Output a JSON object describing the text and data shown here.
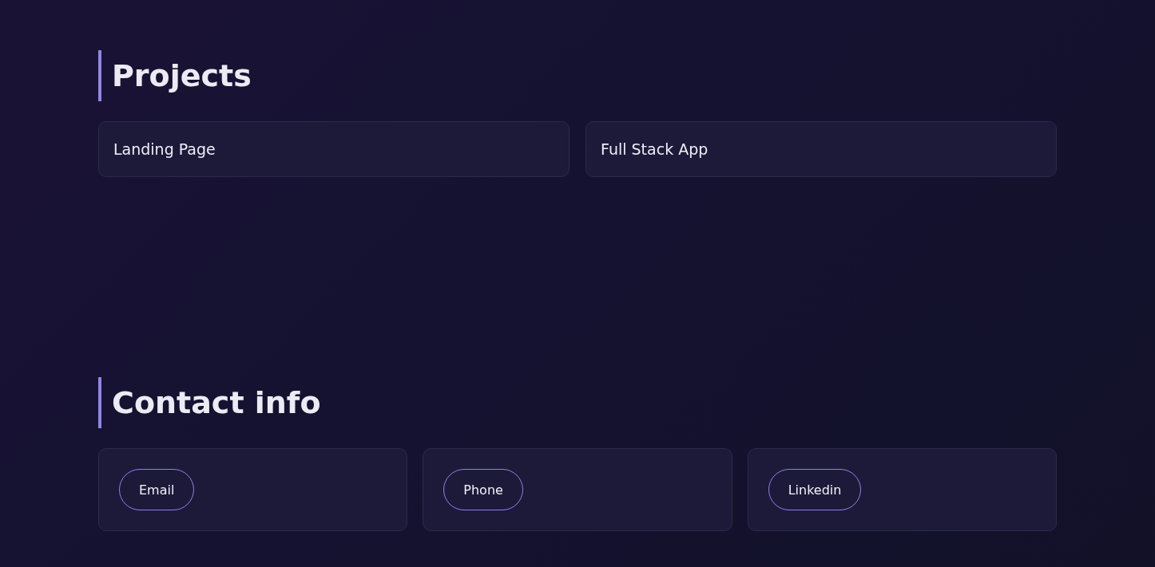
{
  "sections": [
    {
      "title": "Projects",
      "kind": "projects",
      "items": [
        {
          "label": "Landing Page"
        },
        {
          "label": "Full Stack App"
        }
      ]
    },
    {
      "title": "Contact info",
      "kind": "contacts",
      "items": [
        {
          "label": "Email"
        },
        {
          "label": "Phone"
        },
        {
          "label": "Linkedin"
        }
      ]
    }
  ]
}
